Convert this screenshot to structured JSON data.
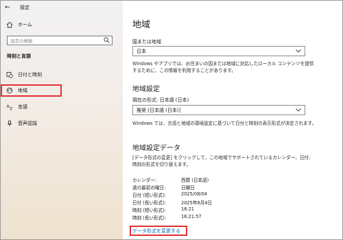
{
  "window": {
    "title": "設定"
  },
  "sidebar": {
    "home_label": "ホーム",
    "search_placeholder": "設定の検索",
    "section_title": "時刻と言語",
    "items": [
      {
        "label": "日付と時刻",
        "icon": "calendar-clock-icon"
      },
      {
        "label": "地域",
        "icon": "globe-region-icon",
        "selected": true
      },
      {
        "label": "言語",
        "icon": "language-icon"
      },
      {
        "label": "音声認識",
        "icon": "microphone-icon"
      }
    ]
  },
  "main": {
    "page_title": "地域",
    "country_label": "国または地域",
    "country_value": "日本",
    "country_desc": "Windows やアプリでは、お住まいの国または地域に対応したローカル コンテンツを提供するために、この情報を利用することがあります。",
    "region_format_heading": "地域設定",
    "current_format_label": "現在の形式: 日本語 (日本)",
    "format_value": "推奨 [日本語 (日本)]",
    "format_desc": "Windows では、言語と地域の環境設定に基づいて日付と時刻の表示形式が決定されます。",
    "region_data_heading": "地域設定データ",
    "region_data_desc": "[データ形式の変更] をクリックして、この地域でサポートされているカレンダー、日付、時刻の形式を切り替えます。",
    "data_rows": [
      {
        "key": "カレンダー:",
        "value": "西暦 (日本語)"
      },
      {
        "key": "週の最初の曜日:",
        "value": "日曜日"
      },
      {
        "key": "日付 (短い形式):",
        "value": "2025/08/04"
      },
      {
        "key": "日付 (長い形式):",
        "value": "2025年8月4日"
      },
      {
        "key": "時刻 (短い形式):",
        "value": "16:21"
      },
      {
        "key": "時刻 (長い形式):",
        "value": "16:21:57"
      }
    ],
    "change_format_link": "データ形式を変更する"
  },
  "colors": {
    "highlight": "#e23030",
    "link": "#0063b1"
  }
}
